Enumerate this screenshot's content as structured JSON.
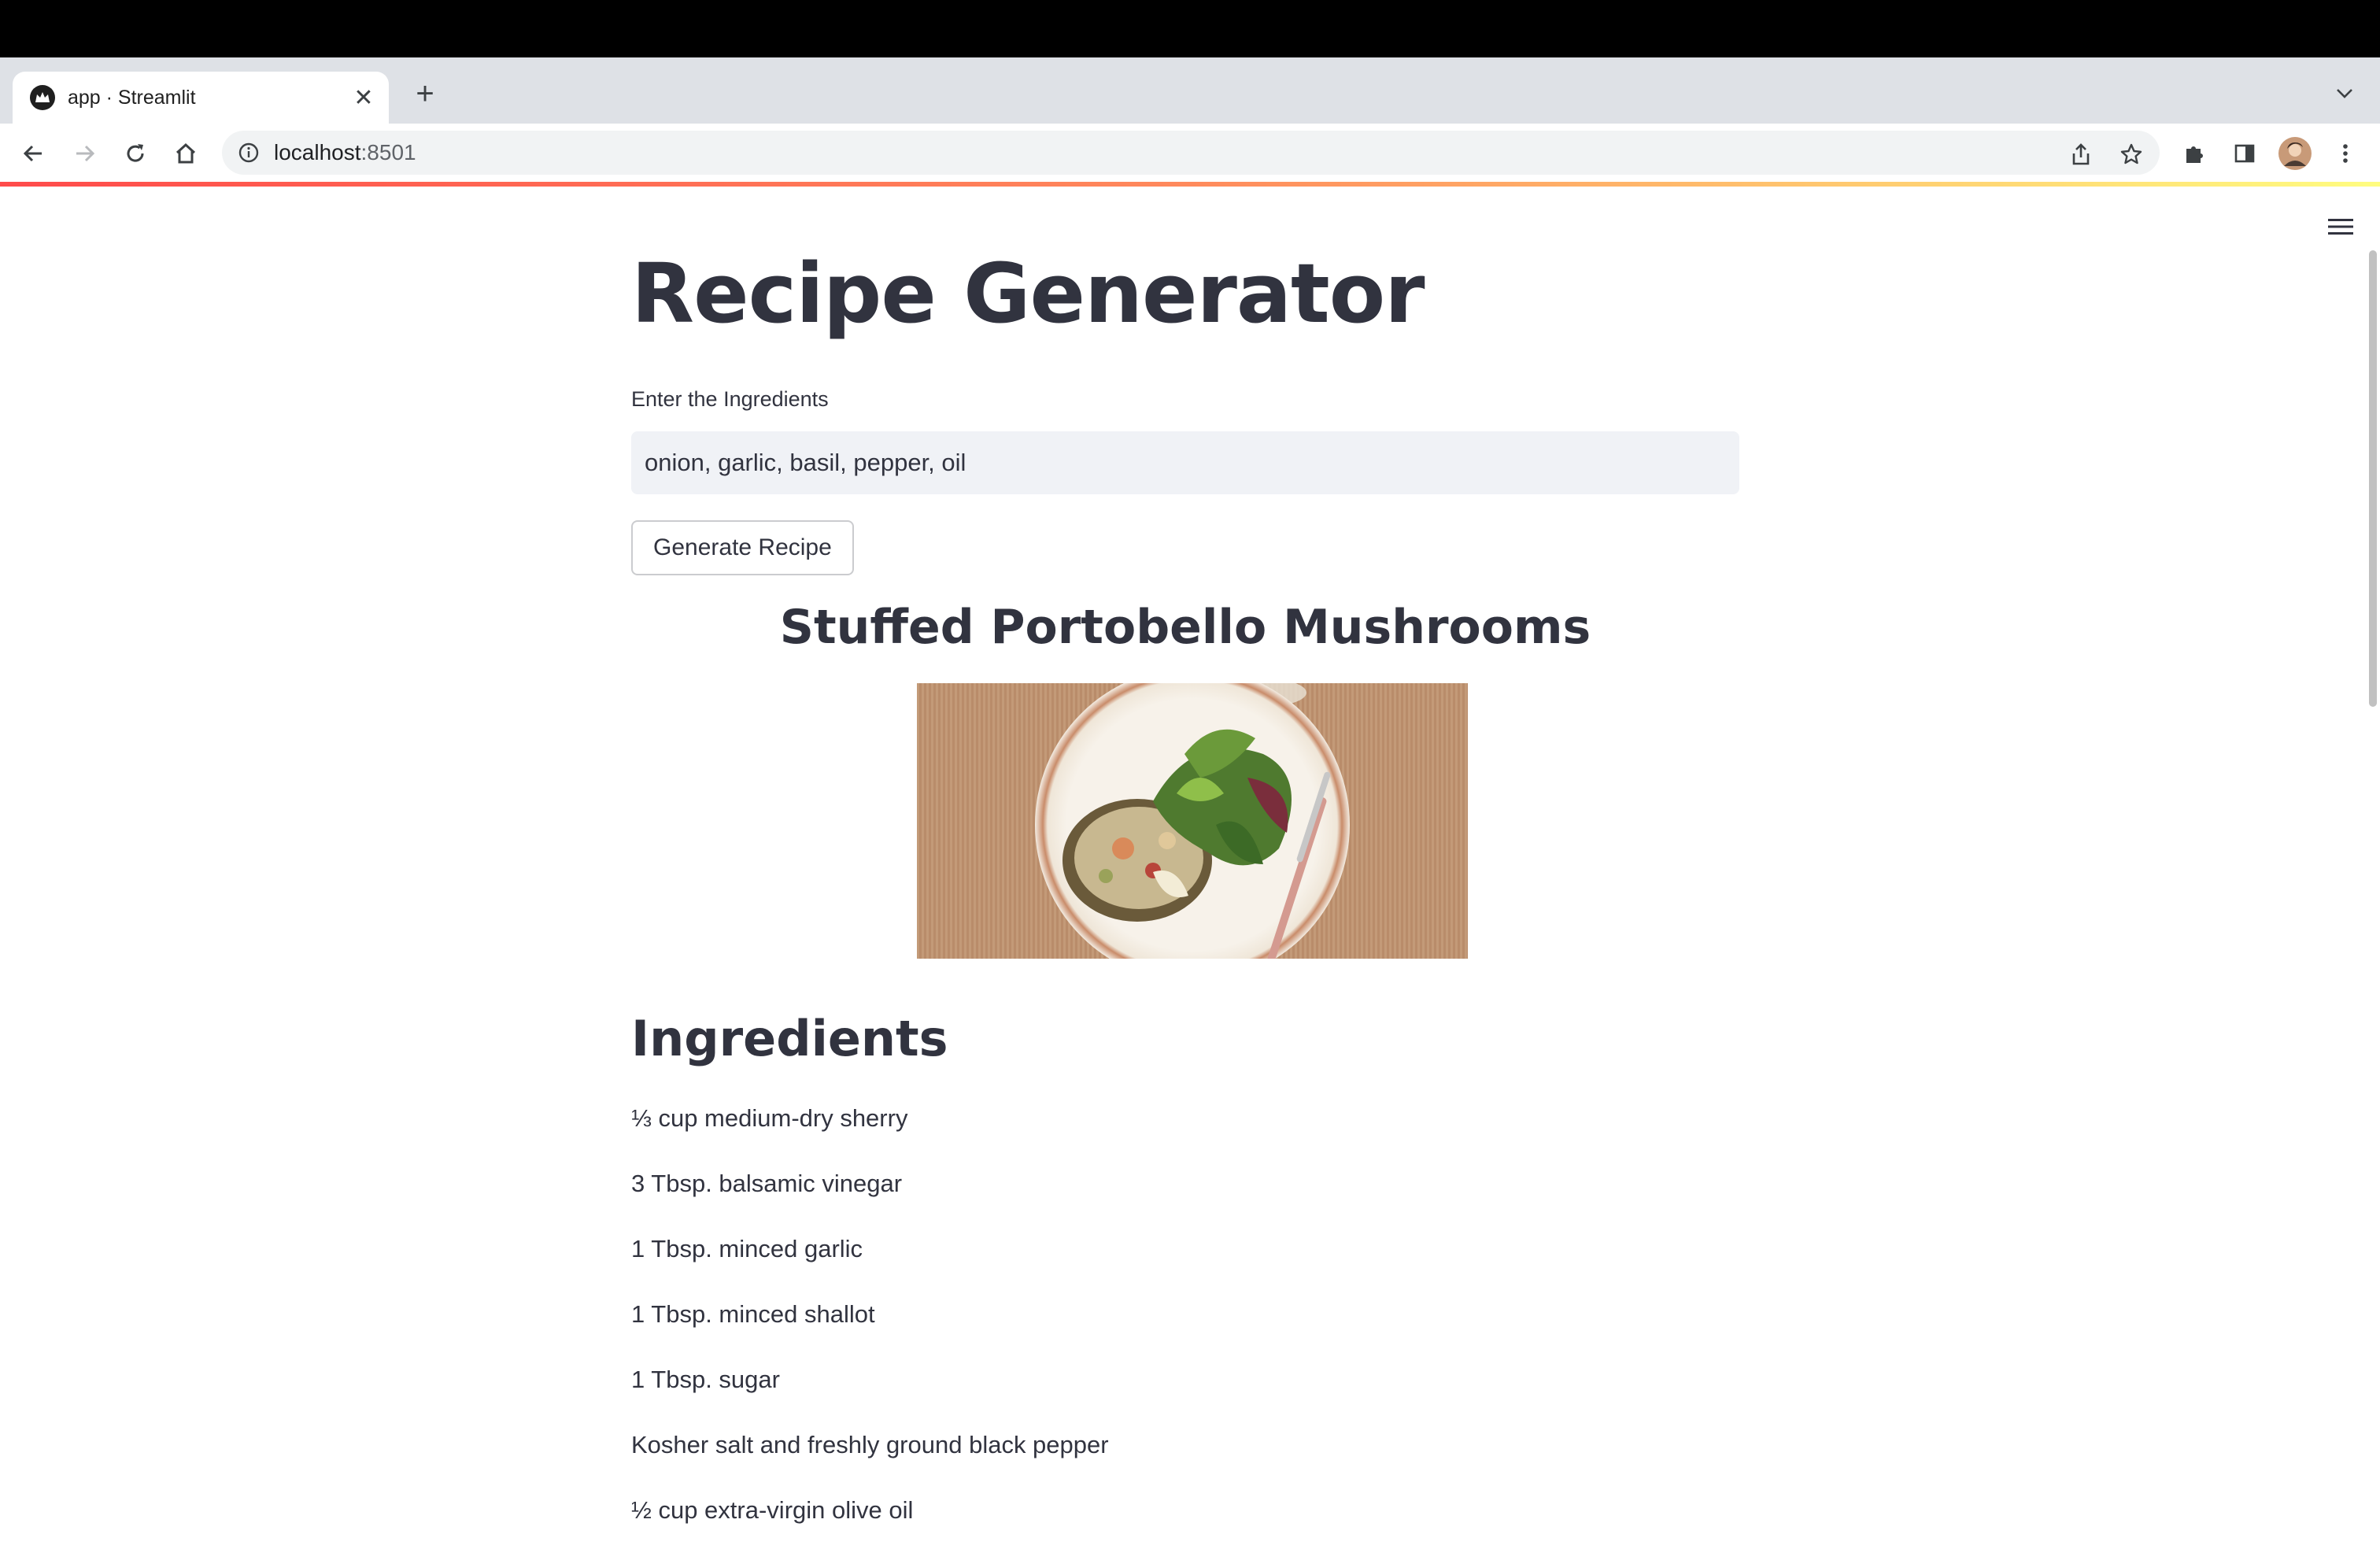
{
  "browser": {
    "tab": {
      "title": "app · Streamlit",
      "favicon": "streamlit-crown-icon"
    },
    "url": {
      "host": "localhost",
      "port": ":8501"
    }
  },
  "app": {
    "title": "Recipe Generator",
    "input_label": "Enter the Ingredients",
    "input_value": "onion, garlic, basil, pepper, oil",
    "button_label": "Generate Recipe",
    "recipe_title": "Stuffed Portobello Mushrooms",
    "image_description": "plated-stuffed-portobello-with-salad",
    "ingredients_heading": "Ingredients",
    "ingredients": [
      "⅓ cup medium-dry sherry",
      "3 Tbsp. balsamic vinegar",
      "1 Tbsp. minced garlic",
      "1 Tbsp. minced shallot",
      "1 Tbsp. sugar",
      "Kosher salt and freshly ground black pepper",
      "½ cup extra-virgin olive oil"
    ]
  },
  "colors": {
    "accent_gradient": [
      "#ff4b4b",
      "#fffd80"
    ],
    "text": "#31333f",
    "input_bg": "#f0f2f6"
  }
}
